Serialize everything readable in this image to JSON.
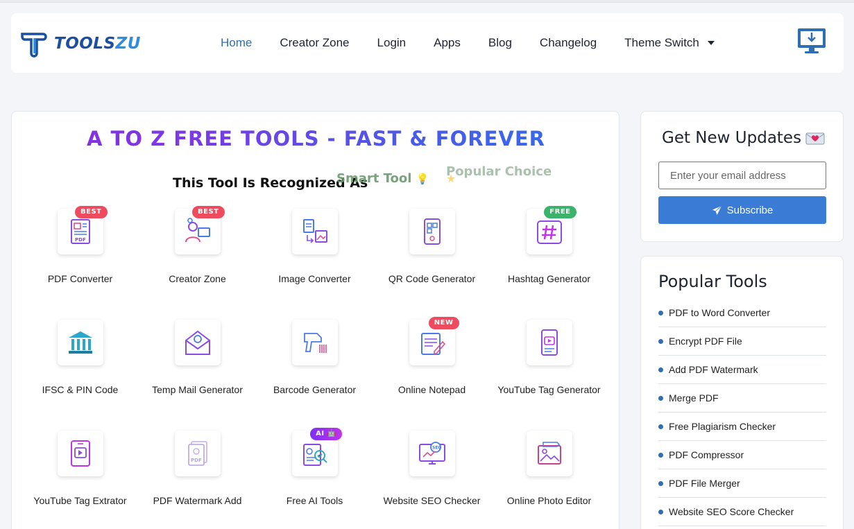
{
  "brand": {
    "name_part1": "TOOLS",
    "name_part2": "ZU",
    "primary": "#1c4fa0",
    "accent": "#2e8de0"
  },
  "nav": {
    "items": [
      "Home",
      "Creator Zone",
      "Login",
      "Apps",
      "Blog",
      "Changelog"
    ],
    "theme_switch": "Theme Switch",
    "active": "Home"
  },
  "main": {
    "hero_title": "A to Z Free Tools - Fast & Forever",
    "recognized_label": "This Tool Is Recognized As",
    "badge_smart": "Smart Tool",
    "badge_popular": "Popular Choice",
    "tools": [
      {
        "label": "PDF Converter",
        "tag": "BEST",
        "tag_color": "red",
        "icon": "pdf-document-icon"
      },
      {
        "label": "Creator Zone",
        "tag": "BEST",
        "tag_color": "red",
        "icon": "creator-icon"
      },
      {
        "label": "Image Converter",
        "tag": "",
        "tag_color": "",
        "icon": "image-convert-icon"
      },
      {
        "label": "QR Code Generator",
        "tag": "",
        "tag_color": "",
        "icon": "qr-phone-icon"
      },
      {
        "label": "Hashtag Generator",
        "tag": "FREE",
        "tag_color": "green",
        "icon": "hashtag-icon"
      },
      {
        "label": "IFSC & PIN Code",
        "tag": "",
        "tag_color": "",
        "icon": "bank-icon"
      },
      {
        "label": "Temp Mail Generator",
        "tag": "",
        "tag_color": "",
        "icon": "mail-icon"
      },
      {
        "label": "Barcode Generator",
        "tag": "",
        "tag_color": "",
        "icon": "barcode-scanner-icon"
      },
      {
        "label": "Online Notepad",
        "tag": "NEW",
        "tag_color": "red",
        "icon": "notepad-icon"
      },
      {
        "label": "YouTube Tag Generator",
        "tag": "",
        "tag_color": "",
        "icon": "video-phone-icon"
      },
      {
        "label": "YouTube Tag Extrator",
        "tag": "",
        "tag_color": "",
        "icon": "video-tablet-icon"
      },
      {
        "label": "PDF Watermark Add",
        "tag": "",
        "tag_color": "",
        "icon": "pdf-watermark-icon"
      },
      {
        "label": "Free AI Tools",
        "tag": "AI 🤖",
        "tag_color": "purple",
        "icon": "ai-analytics-icon"
      },
      {
        "label": "Website SEO Checker",
        "tag": "",
        "tag_color": "",
        "icon": "seo-monitor-icon"
      },
      {
        "label": "Online Photo Editor",
        "tag": "",
        "tag_color": "",
        "icon": "photo-editor-icon"
      }
    ]
  },
  "sidebar": {
    "updates_title": "Get New Updates",
    "email_placeholder": "Enter your email address",
    "subscribe_label": "Subscribe",
    "popular_title": "Popular Tools",
    "popular_items": [
      "PDF to Word Converter",
      "Encrypt PDF File",
      "Add PDF Watermark",
      "Merge PDF",
      "Free Plagiarism Checker",
      "PDF Compressor",
      "PDF File Merger",
      "Website SEO Score Checker"
    ]
  },
  "colors": {
    "link_active": "#2f6fb1",
    "subscribe_bg": "#3a7bd5",
    "tag_red": "#ef4b5e",
    "tag_green": "#3bb36b"
  }
}
